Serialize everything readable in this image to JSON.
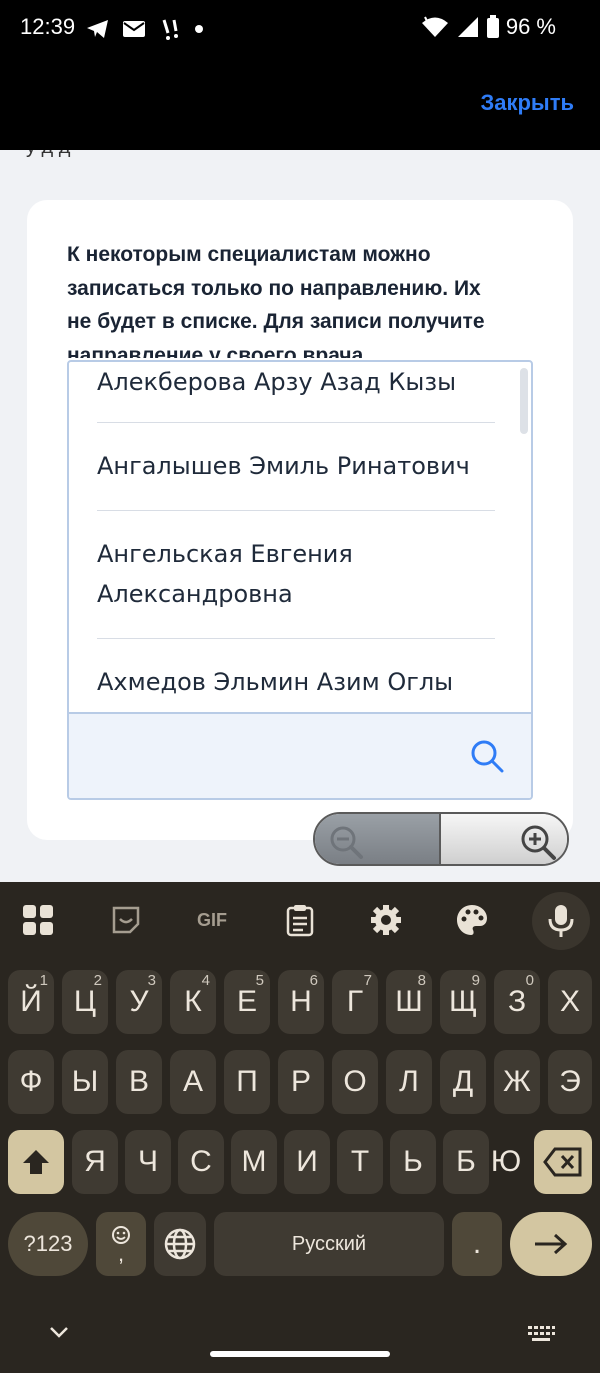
{
  "status": {
    "time": "12:39",
    "battery": "96 %"
  },
  "header": {
    "close_label": "Закрыть"
  },
  "page": {
    "cut_text": "у      д      д"
  },
  "notice": {
    "text": "К некоторым специалистам можно записаться только по направлению. Их не будет в списке. Для записи получите направление у своего врача"
  },
  "doctors": [
    "Алекберова Арзу Азад Кызы",
    "Ангалышев Эмиль Ринатович",
    "Ангельская Евгения Александровна",
    "Ахмедов Эльмин Азим Оглы"
  ],
  "search": {
    "value": "",
    "placeholder": ""
  },
  "keyboard": {
    "toolbar": [
      "apps-icon",
      "sticker-icon",
      "GIF",
      "clipboard-icon",
      "settings-icon",
      "palette-icon",
      "mic-icon"
    ],
    "row1": [
      {
        "label": "Й",
        "num": "1"
      },
      {
        "label": "Ц",
        "num": "2"
      },
      {
        "label": "У",
        "num": "3"
      },
      {
        "label": "К",
        "num": "4"
      },
      {
        "label": "Е",
        "num": "5"
      },
      {
        "label": "Н",
        "num": "6"
      },
      {
        "label": "Г",
        "num": "7"
      },
      {
        "label": "Ш",
        "num": "8"
      },
      {
        "label": "Щ",
        "num": "9"
      },
      {
        "label": "З",
        "num": "0"
      },
      {
        "label": "Х",
        "num": ""
      }
    ],
    "row2": [
      "Ф",
      "Ы",
      "В",
      "А",
      "П",
      "Р",
      "О",
      "Л",
      "Д",
      "Ж",
      "Э"
    ],
    "row3": [
      "Я",
      "Ч",
      "С",
      "М",
      "И",
      "Т",
      "Ь",
      "Б",
      "Ю"
    ],
    "num_switch": "?123",
    "emoji_comma": ",",
    "space": "Русский",
    "period": "."
  },
  "colors": {
    "accent": "#2f7cf6",
    "keyboard_bg": "#2a2620",
    "key_bg": "#3f3a32",
    "key_special": "#d3c6a1"
  }
}
